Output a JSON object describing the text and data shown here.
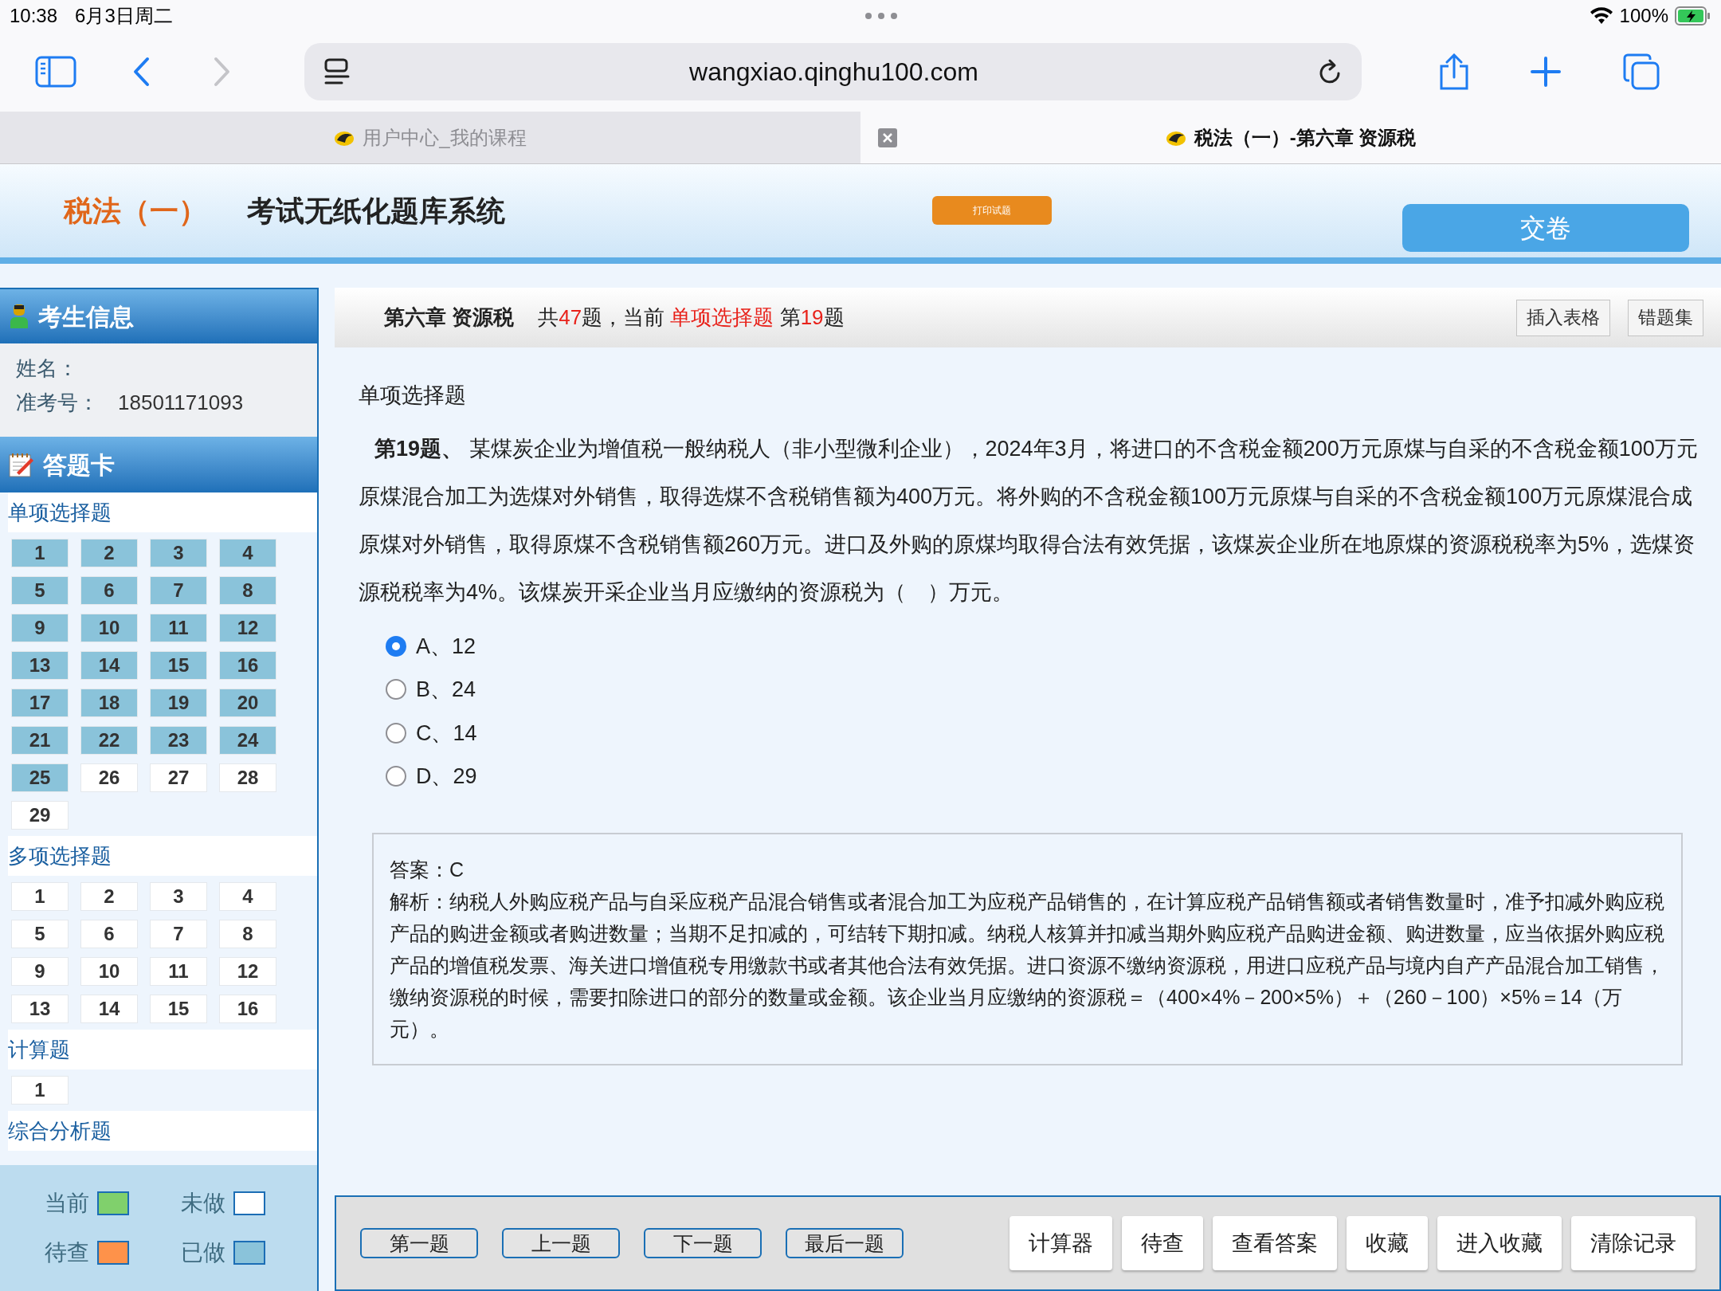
{
  "status_bar": {
    "time": "10:38",
    "date": "6月3日周二",
    "battery": "100%"
  },
  "browser": {
    "url": "wangxiao.qinghu100.com",
    "forward_disabled": true
  },
  "tabs": [
    {
      "title": "用户中心_我的课程",
      "selected": false
    },
    {
      "title": "税法（一）-第六章 资源税",
      "selected": true
    }
  ],
  "header": {
    "subject": "税法（一）",
    "system_title": "考试无纸化题库系统",
    "print_button": "打印试题",
    "submit_button": "交卷"
  },
  "sidebar": {
    "candidate_title": "考生信息",
    "name_label": "姓名：",
    "id_label": "准考号：",
    "id_value": "18501171093",
    "card_title": "答题卡",
    "sections": [
      {
        "title": "单项选择题",
        "items": [
          {
            "label": "1",
            "answered": true
          },
          {
            "label": "2",
            "answered": true
          },
          {
            "label": "3",
            "answered": true
          },
          {
            "label": "4",
            "answered": true
          },
          {
            "label": "5",
            "answered": true
          },
          {
            "label": "6",
            "answered": true
          },
          {
            "label": "7",
            "answered": true
          },
          {
            "label": "8",
            "answered": true
          },
          {
            "label": "9",
            "answered": true
          },
          {
            "label": "10",
            "answered": true
          },
          {
            "label": "11",
            "answered": true
          },
          {
            "label": "12",
            "answered": true
          },
          {
            "label": "13",
            "answered": true
          },
          {
            "label": "14",
            "answered": true
          },
          {
            "label": "15",
            "answered": true
          },
          {
            "label": "16",
            "answered": true
          },
          {
            "label": "17",
            "answered": true
          },
          {
            "label": "18",
            "answered": true
          },
          {
            "label": "19",
            "answered": true
          },
          {
            "label": "20",
            "answered": true
          },
          {
            "label": "21",
            "answered": true
          },
          {
            "label": "22",
            "answered": true
          },
          {
            "label": "23",
            "answered": true
          },
          {
            "label": "24",
            "answered": true
          },
          {
            "label": "25",
            "answered": true
          },
          {
            "label": "26",
            "answered": false
          },
          {
            "label": "27",
            "answered": false
          },
          {
            "label": "28",
            "answered": false
          },
          {
            "label": "29",
            "answered": false
          }
        ]
      },
      {
        "title": "多项选择题",
        "items": [
          {
            "label": "1",
            "answered": false
          },
          {
            "label": "2",
            "answered": false
          },
          {
            "label": "3",
            "answered": false
          },
          {
            "label": "4",
            "answered": false
          },
          {
            "label": "5",
            "answered": false
          },
          {
            "label": "6",
            "answered": false
          },
          {
            "label": "7",
            "answered": false
          },
          {
            "label": "8",
            "answered": false
          },
          {
            "label": "9",
            "answered": false
          },
          {
            "label": "10",
            "answered": false
          },
          {
            "label": "11",
            "answered": false
          },
          {
            "label": "12",
            "answered": false
          },
          {
            "label": "13",
            "answered": false
          },
          {
            "label": "14",
            "answered": false
          },
          {
            "label": "15",
            "answered": false
          },
          {
            "label": "16",
            "answered": false
          }
        ]
      },
      {
        "title": "计算题",
        "items": [
          {
            "label": "1",
            "answered": false
          }
        ]
      },
      {
        "title": "综合分析题"
      }
    ],
    "legend": [
      {
        "label": "当前",
        "color": "#80d06c"
      },
      {
        "label": "未做",
        "color": "#ffffff"
      },
      {
        "label": "待查",
        "color": "#fe924a"
      },
      {
        "label": "已做",
        "color": "#8ac3da"
      }
    ]
  },
  "main": {
    "chapter": "第六章 资源税",
    "summary": [
      {
        "text": "共",
        "highlight": false
      },
      {
        "text": "47",
        "highlight": true
      },
      {
        "text": "题，当前 ",
        "highlight": false
      },
      {
        "text": "单项选择题",
        "highlight": true
      },
      {
        "text": " 第",
        "highlight": false
      },
      {
        "text": "19",
        "highlight": true
      },
      {
        "text": "题",
        "highlight": false
      }
    ],
    "toolbar_buttons": [
      "插入表格",
      "错题集"
    ],
    "question": {
      "type_label": "单项选择题",
      "text": "**第19题、** 某煤炭企业为增值税一般纳税人（非小型微利企业），2024年3月，将进口的不含税金额200万元原煤与自采的不含税金额100万元原煤混合加工为选煤对外销售，取得选煤不含税销售额为400万元。将外购的不含税金额100万元原煤与自采的不含税金额100万元原煤混合成原煤对外销售，取得原煤不含税销售额260万元。进口及外购的原煤均取得合法有效凭据，该煤炭企业所在地原煤的资源税税率为5%，选煤资源税税率为4%。该煤炭开采企业当月应缴纳的资源税为（　）万元。",
      "options": [
        {
          "label": "A、12",
          "selected": true
        },
        {
          "label": "B、24",
          "selected": false
        },
        {
          "label": "C、14",
          "selected": false
        },
        {
          "label": "D、29",
          "selected": false
        }
      ]
    },
    "answer": {
      "answer": "答案：C",
      "analysis": "解析：纳税人外购应税产品与自采应税产品混合销售或者混合加工为应税产品销售的，在计算应税产品销售额或者销售数量时，准予扣减外购应税产品的购进金额或者购进数量；当期不足扣减的，可结转下期扣减。纳税人核算并扣减当期外购应税产品购进金额、购进数量，应当依据外购应税产品的增值税发票、海关进口增值税专用缴款书或者其他合法有效凭据。进口资源不缴纳资源税，用进口应税产品与境内自产产品混合加工销售，缴纳资源税的时候，需要扣除进口的部分的数量或金额。该企业当月应缴纳的资源税＝（400×4%－200×5%）＋（260－100）×5%＝14（万元）。"
    }
  },
  "footer": {
    "nav_buttons": [
      "第一题",
      "上一题",
      "下一题",
      "最后一题"
    ],
    "tool_buttons": [
      "计算器",
      "待查",
      "查看答案",
      "收藏",
      "进入收藏",
      "清除记录"
    ]
  }
}
